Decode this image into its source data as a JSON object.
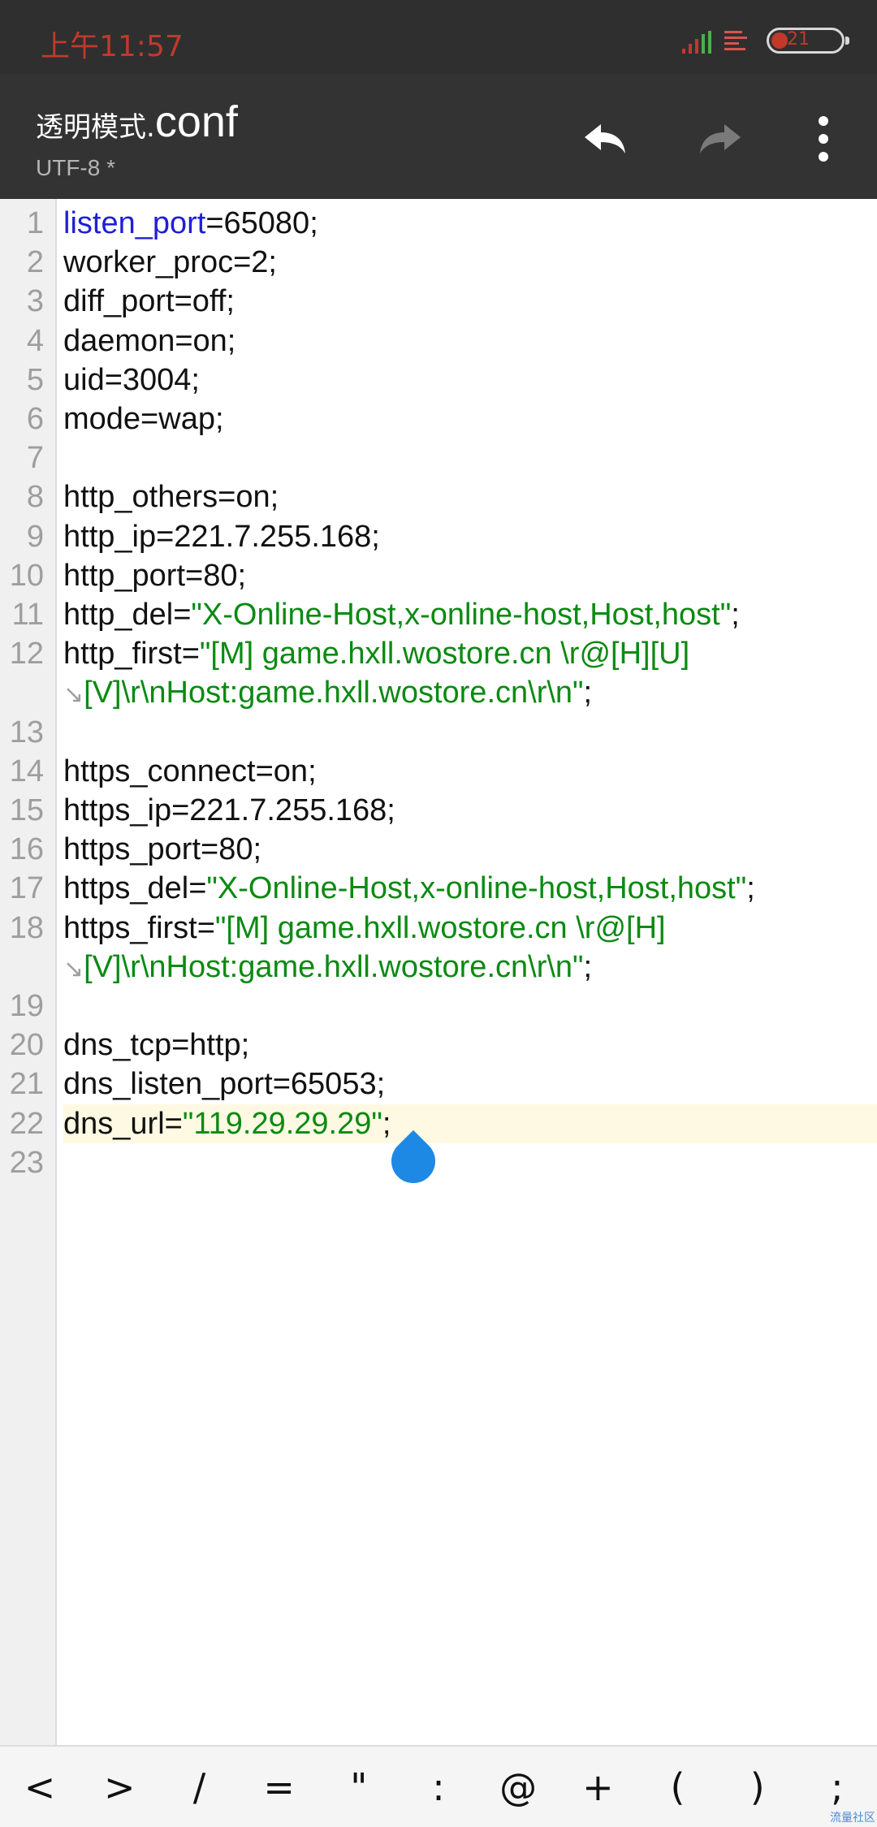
{
  "status_bar": {
    "time": "上午11:57",
    "battery": "21"
  },
  "toolbar": {
    "title_main": "透明模式.",
    "title_ext": "conf",
    "encoding": "UTF-8 *",
    "undo_icon": "undo-icon",
    "redo_icon": "redo-icon",
    "more_icon": "more-vert-icon"
  },
  "editor": {
    "line_numbers": [
      "1",
      "2",
      "3",
      "4",
      "5",
      "6",
      "7",
      "8",
      "9",
      "10",
      "11",
      "12",
      "13",
      "14",
      "15",
      "16",
      "17",
      "18",
      "19",
      "20",
      "21",
      "22",
      "23"
    ],
    "lines": [
      {
        "n": "1",
        "segments": [
          {
            "t": "listen_port",
            "c": "kw"
          },
          {
            "t": "=65080;",
            "c": ""
          }
        ]
      },
      {
        "n": "2",
        "segments": [
          {
            "t": "worker_proc=2;",
            "c": ""
          }
        ]
      },
      {
        "n": "3",
        "segments": [
          {
            "t": "diff_port=off;",
            "c": ""
          }
        ]
      },
      {
        "n": "4",
        "segments": [
          {
            "t": "daemon=on;",
            "c": ""
          }
        ]
      },
      {
        "n": "5",
        "segments": [
          {
            "t": "uid=3004;",
            "c": ""
          }
        ]
      },
      {
        "n": "6",
        "segments": [
          {
            "t": "mode=wap;",
            "c": ""
          }
        ]
      },
      {
        "n": "7",
        "segments": []
      },
      {
        "n": "8",
        "segments": [
          {
            "t": "http_others=on;",
            "c": ""
          }
        ]
      },
      {
        "n": "9",
        "segments": [
          {
            "t": "http_ip=221.7.255.168;",
            "c": ""
          }
        ]
      },
      {
        "n": "10",
        "segments": [
          {
            "t": "http_port=80;",
            "c": ""
          }
        ]
      },
      {
        "n": "11",
        "segments": [
          {
            "t": "http_del=",
            "c": ""
          },
          {
            "t": "\"X-Online-Host,x-online-host,Host,host\"",
            "c": "str"
          },
          {
            "t": ";",
            "c": ""
          }
        ]
      },
      {
        "n": "12",
        "segments": [
          {
            "t": "http_first=",
            "c": ""
          },
          {
            "t": "\"[M] game.hxll.wostore.cn \\r@[H][U]",
            "c": "str"
          }
        ]
      },
      {
        "n": "",
        "wrap": true,
        "segments": [
          {
            "t": "[V]\\r\\nHost:game.hxll.wostore.cn\\r\\n\"",
            "c": "str"
          },
          {
            "t": ";",
            "c": ""
          }
        ]
      },
      {
        "n": "13",
        "segments": []
      },
      {
        "n": "14",
        "segments": [
          {
            "t": "https_connect=on;",
            "c": ""
          }
        ]
      },
      {
        "n": "15",
        "segments": [
          {
            "t": "https_ip=221.7.255.168;",
            "c": ""
          }
        ]
      },
      {
        "n": "16",
        "segments": [
          {
            "t": "https_port=80;",
            "c": ""
          }
        ]
      },
      {
        "n": "17",
        "segments": [
          {
            "t": "https_del=",
            "c": ""
          },
          {
            "t": "\"X-Online-Host,x-online-host,Host,host\"",
            "c": "str"
          },
          {
            "t": ";",
            "c": ""
          }
        ]
      },
      {
        "n": "18",
        "segments": [
          {
            "t": "https_first=",
            "c": ""
          },
          {
            "t": "\"[M] game.hxll.wostore.cn \\r@[H]",
            "c": "str"
          }
        ]
      },
      {
        "n": "",
        "wrap": true,
        "segments": [
          {
            "t": "[V]\\r\\nHost:game.hxll.wostore.cn\\r\\n\"",
            "c": "str"
          },
          {
            "t": ";",
            "c": ""
          }
        ]
      },
      {
        "n": "19",
        "segments": []
      },
      {
        "n": "20",
        "segments": [
          {
            "t": "dns_tcp=http;",
            "c": ""
          }
        ]
      },
      {
        "n": "21",
        "segments": [
          {
            "t": "dns_listen_port=65053;",
            "c": ""
          }
        ]
      },
      {
        "n": "22",
        "highlight": true,
        "segments": [
          {
            "t": "dns_url=",
            "c": ""
          },
          {
            "t": "\"119.29.29.29\"",
            "c": "str"
          },
          {
            "t": ";",
            "c": ""
          }
        ]
      },
      {
        "n": "23",
        "segments": []
      }
    ]
  },
  "key_bar": {
    "keys": [
      "<",
      ">",
      "/",
      "=",
      "\"",
      ":",
      "@",
      "+",
      "(",
      ")",
      ";"
    ]
  },
  "watermark": "流量社区"
}
